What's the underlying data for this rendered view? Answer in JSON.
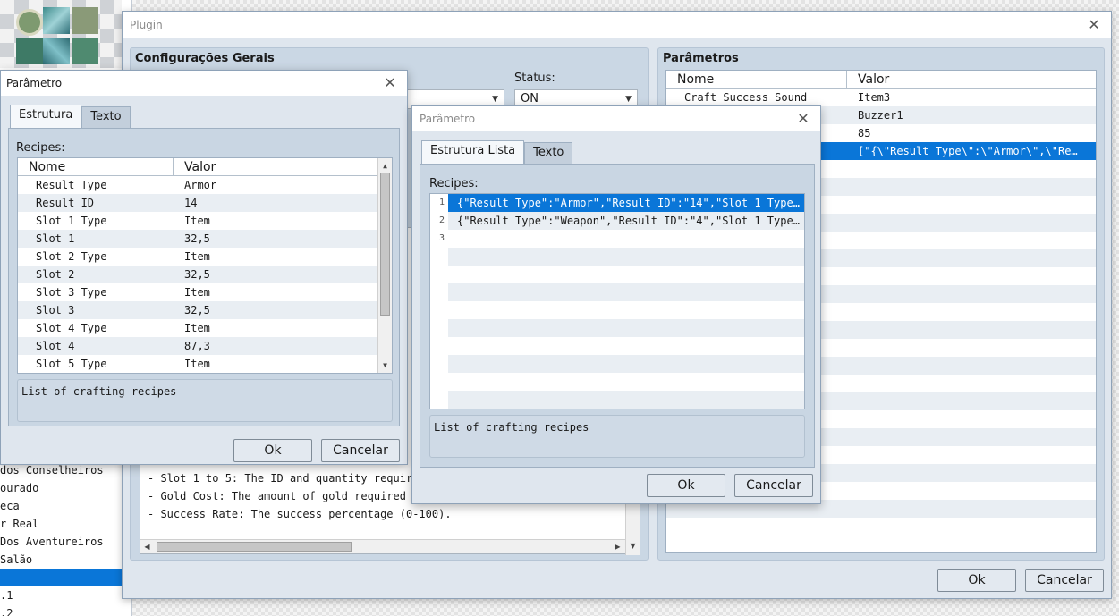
{
  "background": {
    "list_items": [
      "dos Conselheiros",
      "ourado",
      "eca",
      "r Real",
      "Dos Aventureiros",
      "Salão",
      "",
      ".1",
      ".2"
    ],
    "selected_index": 6
  },
  "plugin": {
    "title": "Plugin",
    "general_title": "Configurações Gerais",
    "status_label": "Status:",
    "status_value": "ON",
    "help_lines": [
      "- Slot 1 to 5: The ID and quantity required",
      "- Gold Cost: The amount of gold required to c",
      "- Success Rate: The success percentage (0-100)."
    ],
    "params_title": "Parâmetros",
    "params_headers": [
      "Nome",
      "Valor"
    ],
    "params_rows": [
      {
        "name": "Craft Success Sound",
        "value": "Item3"
      },
      {
        "name": "",
        "value": "Buzzer1"
      },
      {
        "name": "",
        "value": "85"
      },
      {
        "name": "",
        "value": "[\"{\\\"Result Type\\\":\\\"Armor\\\",\\\"Res…"
      }
    ],
    "ok_label": "Ok",
    "cancel_label": "Cancelar"
  },
  "dialog1": {
    "title": "Parâmetro",
    "tabs": [
      "Estrutura",
      "Texto"
    ],
    "recipes_label": "Recipes:",
    "headers": [
      "Nome",
      "Valor"
    ],
    "rows": [
      {
        "name": "Result Type",
        "value": "Armor"
      },
      {
        "name": "Result ID",
        "value": "14"
      },
      {
        "name": "Slot 1 Type",
        "value": "Item"
      },
      {
        "name": "Slot 1",
        "value": "32,5"
      },
      {
        "name": "Slot 2 Type",
        "value": "Item"
      },
      {
        "name": "Slot 2",
        "value": "32,5"
      },
      {
        "name": "Slot 3 Type",
        "value": "Item"
      },
      {
        "name": "Slot 3",
        "value": "32,5"
      },
      {
        "name": "Slot 4 Type",
        "value": "Item"
      },
      {
        "name": "Slot 4",
        "value": "87,3"
      },
      {
        "name": "Slot 5 Type",
        "value": "Item"
      }
    ],
    "description": "List of crafting recipes",
    "ok_label": "Ok",
    "cancel_label": "Cancelar"
  },
  "dialog2": {
    "title": "Parâmetro",
    "tabs": [
      "Estrutura Lista",
      "Texto"
    ],
    "recipes_label": "Recipes:",
    "lines": [
      {
        "num": "1",
        "text": "{\"Result Type\":\"Armor\",\"Result ID\":\"14\",\"Slot 1 Type\":…"
      },
      {
        "num": "2",
        "text": "{\"Result Type\":\"Weapon\",\"Result ID\":\"4\",\"Slot 1 Type\":…"
      },
      {
        "num": "3",
        "text": ""
      }
    ],
    "description": "List of crafting recipes",
    "ok_label": "Ok",
    "cancel_label": "Cancelar"
  },
  "colors": {
    "selection": "#0a76d8",
    "panel": "#cad7e4",
    "window": "#dfe6ee"
  }
}
